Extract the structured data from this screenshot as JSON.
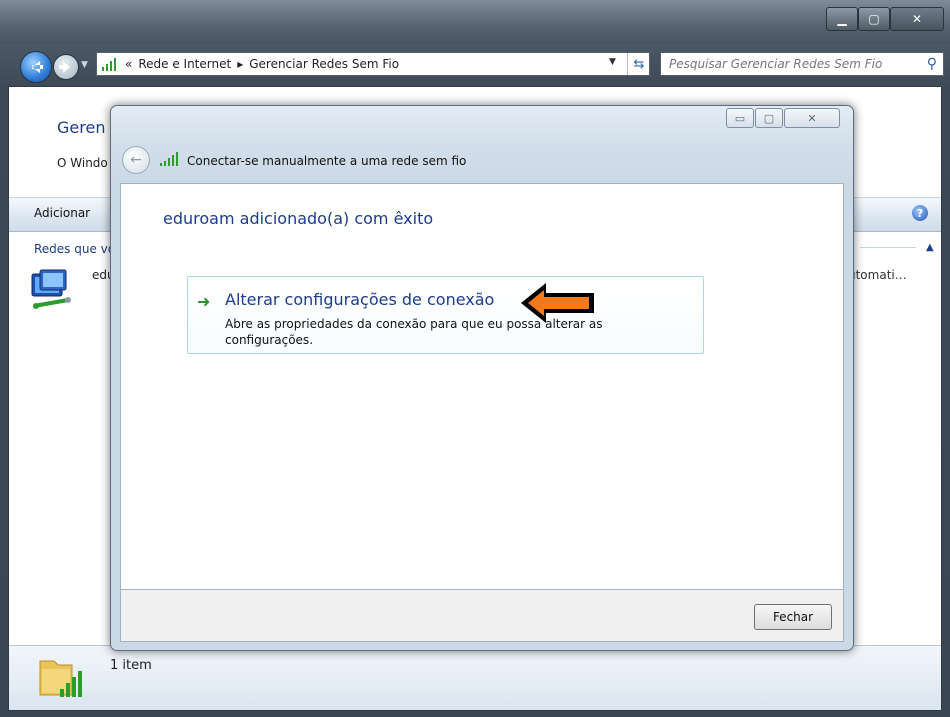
{
  "titlebar": {
    "minimize": "▁",
    "maximize": "▢",
    "close": "✕"
  },
  "breadcrumb": {
    "prefix": "«",
    "item1": "Rede e Internet",
    "sep": "▸",
    "item2": "Gerenciar Redes Sem Fio"
  },
  "search": {
    "placeholder": "Pesquisar Gerenciar Redes Sem Fio"
  },
  "outer": {
    "title_partial": "Geren",
    "subtitle_partial": "O Windo",
    "toolbar_add": "Adicionar",
    "group_header_partial": "Redes que vo",
    "network_name_partial": "edu",
    "network_mode_partial": "utomati…"
  },
  "status": {
    "count": "1 item"
  },
  "dialog": {
    "title": "Conectar-se manualmente a uma rede sem fio",
    "heading": "eduroam adicionado(a) com êxito",
    "link_title": "Alterar configurações de conexão",
    "link_desc": "Abre as propriedades da conexão para que eu possa alterar as configurações.",
    "close_button": "Fechar",
    "min": "▭",
    "max": "▢",
    "x": "✕"
  },
  "colors": {
    "accent": "#1e3c8c",
    "annotation_arrow": "#f07a1e",
    "link_border": "#a9d7ef"
  }
}
